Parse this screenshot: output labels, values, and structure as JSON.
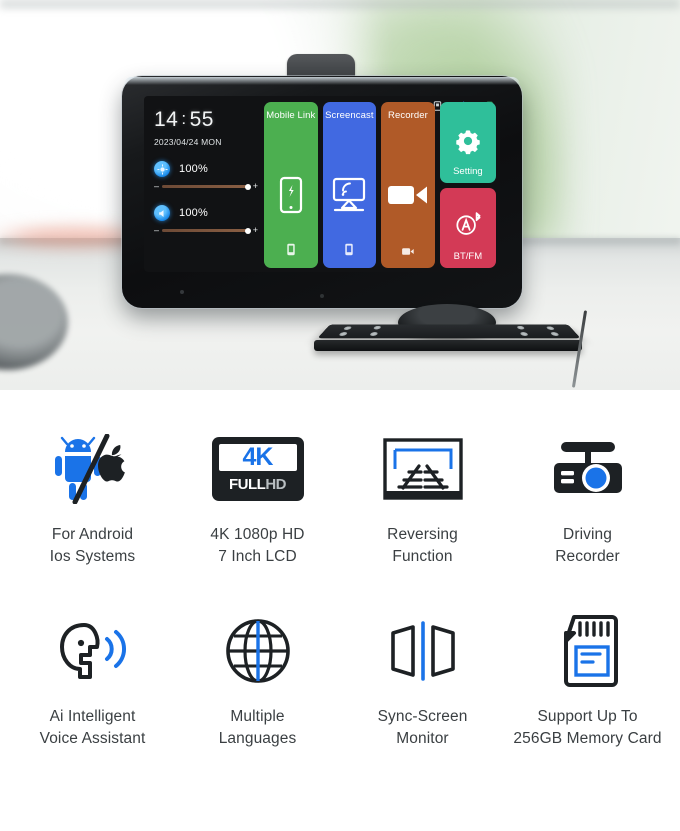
{
  "photo": {
    "alt_description": "Car dashboard mounted 7 inch touchscreen head unit photographed through a windshield",
    "device": {
      "screen": {
        "clock": {
          "hours": "14",
          "colon": ":",
          "minutes": "55"
        },
        "date": "2023/04/24 MON",
        "status_icons": [
          "sd-card-icon",
          "gps-icon",
          "bluetooth-icon",
          "wifi-icon",
          "battery-icon"
        ],
        "sliders": [
          {
            "name": "brightness",
            "icon": "brightness-icon",
            "value": "100%",
            "minus": "–",
            "plus": "+"
          },
          {
            "name": "volume",
            "icon": "volume-icon",
            "value": "100%",
            "minus": "–",
            "plus": "+"
          }
        ],
        "tiles": [
          {
            "label": "Mobile Link",
            "color": "#4caf50",
            "icon": "smartphone-icon",
            "badge": "phone-badge-icon",
            "label_position": "top"
          },
          {
            "label": "Screencast",
            "color": "#4169e1",
            "icon": "screencast-monitor-icon",
            "badge": "phone-badge-icon",
            "label_position": "top"
          },
          {
            "label": "Recorder",
            "color": "#b05a28",
            "icon": "video-camera-icon",
            "badge": "camcorder-badge-icon",
            "label_position": "top"
          },
          {
            "label": "Setting",
            "color": "#2fbf9a",
            "icon": "gear-icon",
            "label_position": "bottom"
          },
          {
            "label": "BT/FM",
            "color": "#d33a56",
            "icon": "radio-tower-bluetooth-icon",
            "label_position": "bottom"
          }
        ]
      },
      "mount": {
        "name": "dashboard-mount-bracket",
        "cable": "power-cable"
      },
      "top_nub": "camera-antenna-nub"
    }
  },
  "features": {
    "rows": [
      [
        {
          "icon": "android-apple-icon",
          "caption_line1": "For  Android",
          "caption_line2": "Ios Systems"
        },
        {
          "icon": "4k-fullhd-badge-icon",
          "badge_top": "4K",
          "badge_full": "FULL",
          "badge_hd": "HD",
          "caption_line1": "4K 1080p HD",
          "caption_line2": "7 Inch LCD"
        },
        {
          "icon": "reversing-guidelines-icon",
          "caption_line1": "Reversing",
          "caption_line2": "Function"
        },
        {
          "icon": "dash-cam-icon",
          "caption_line1": "Driving",
          "caption_line2": "Recorder"
        }
      ],
      [
        {
          "icon": "voice-assistant-icon",
          "caption_line1": "Ai Intelligent",
          "caption_line2": "Voice Assistant"
        },
        {
          "icon": "globe-icon",
          "caption_line1": "Multiple",
          "caption_line2": "Languages"
        },
        {
          "icon": "sync-screen-icon",
          "caption_line1": "Sync-Screen",
          "caption_line2": "Monitor"
        },
        {
          "icon": "memory-card-icon",
          "caption_line1": "Support Up To",
          "caption_line2": "256GB Memory Card"
        }
      ]
    ]
  },
  "colors": {
    "accent_blue": "#1a73e8",
    "icon_dark": "#1d2124",
    "caption_text": "#3a3f42",
    "tile_green": "#4caf50",
    "tile_blue": "#4169e1",
    "tile_orange": "#b05a28",
    "tile_teal": "#2fbf9a",
    "tile_red": "#d33a56"
  }
}
